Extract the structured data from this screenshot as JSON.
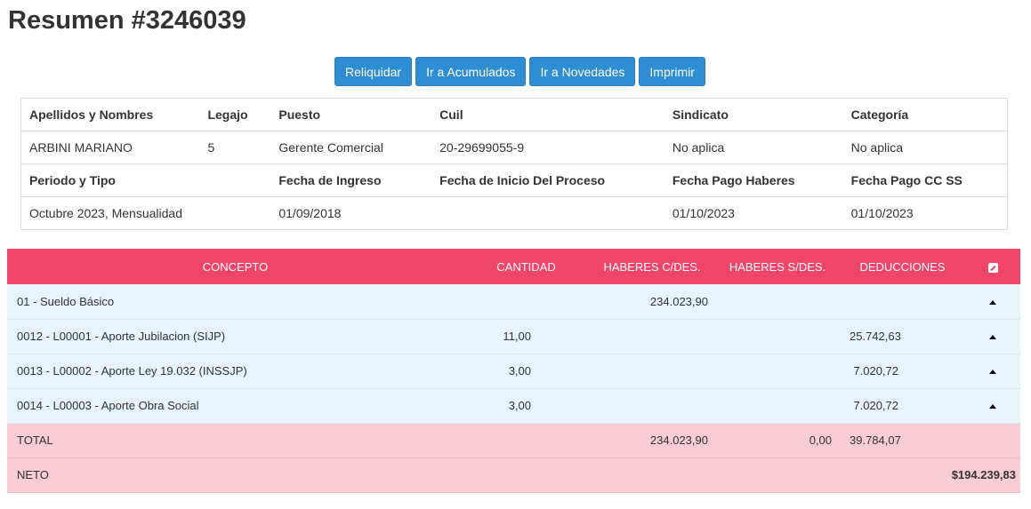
{
  "page": {
    "title": "Resumen #3246039"
  },
  "actions": {
    "reliquidar": "Reliquidar",
    "acumulados": "Ir a Acumulados",
    "novedades": "Ir a Novedades",
    "imprimir": "Imprimir"
  },
  "info": {
    "headers1": [
      "Apellidos y Nombres",
      "Legajo",
      "Puesto",
      "Cuil",
      "Sindicato",
      "Categoría"
    ],
    "values1": [
      "ARBINI MARIANO",
      "5",
      "Gerente Comercial",
      "20-29699055-9",
      "No aplica",
      "No aplica"
    ],
    "headers2": [
      "Periodo y Tipo",
      "",
      "Fecha de Ingreso",
      "Fecha de Inicio Del Proceso",
      "Fecha Pago Haberes",
      "Fecha Pago CC SS"
    ],
    "values2": [
      "Octubre 2023, Mensualidad",
      "",
      "01/09/2018",
      "",
      "01/10/2023",
      "01/10/2023"
    ]
  },
  "concepts": {
    "columns": [
      "CONCEPTO",
      "CANTIDAD",
      "HABERES C/DES.",
      "HABERES S/DES.",
      "DEDUCCIONES"
    ],
    "rows": [
      {
        "concepto": "01 - Sueldo Básico",
        "cantidad": "",
        "haberes_c": "234.023,90",
        "haberes_s": "",
        "deducciones": ""
      },
      {
        "concepto": "0012 - L00001 - Aporte Jubilacion (SIJP)",
        "cantidad": "11,00",
        "haberes_c": "",
        "haberes_s": "",
        "deducciones": "25.742,63"
      },
      {
        "concepto": "0013 - L00002 - Aporte Ley 19.032 (INSSJP)",
        "cantidad": "3,00",
        "haberes_c": "",
        "haberes_s": "",
        "deducciones": "7.020,72"
      },
      {
        "concepto": "0014 - L00003 - Aporte Obra Social",
        "cantidad": "3,00",
        "haberes_c": "",
        "haberes_s": "",
        "deducciones": "7.020,72"
      }
    ],
    "total": {
      "label": "TOTAL",
      "haberes_c": "234.023,90",
      "haberes_s": "0,00",
      "deducciones": "39.784,07"
    },
    "neto": {
      "label": "NETO",
      "value": "$194.239,83"
    }
  },
  "icons": {
    "edit": "edit-icon",
    "row_toggle": "triangle-up-icon"
  },
  "colors": {
    "header": "#ef4568",
    "row": "#e8f4fb",
    "summary": "#f9ccd6",
    "button": "#2e8dd3"
  }
}
